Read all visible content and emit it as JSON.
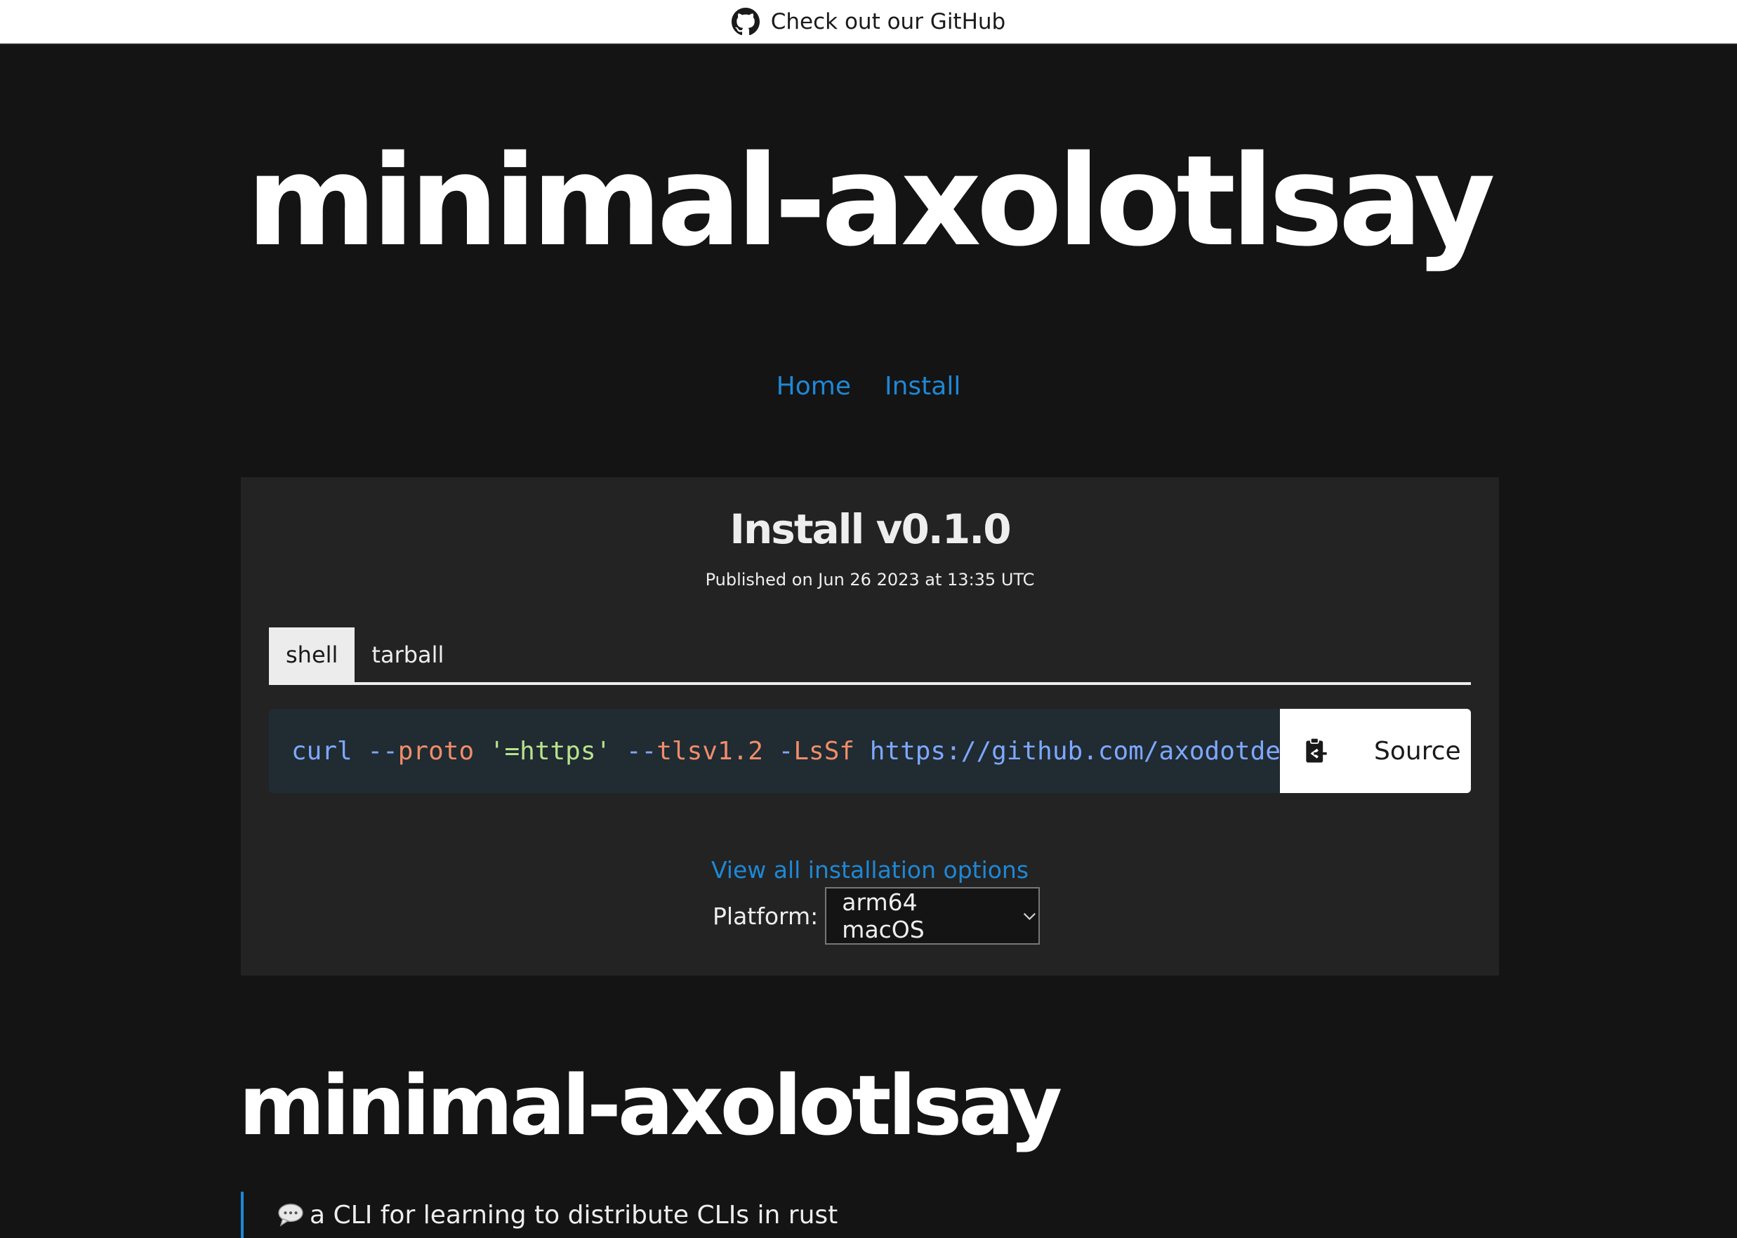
{
  "banner": {
    "icon": "github-icon",
    "text": "Check out our GitHub"
  },
  "hero": {
    "title": "minimal-axolotlsay"
  },
  "nav": {
    "items": [
      {
        "label": "Home"
      },
      {
        "label": "Install"
      }
    ]
  },
  "install": {
    "title": "Install v0.1.0",
    "published": "Published on Jun 26 2023 at 13:35 UTC",
    "tabs": [
      {
        "label": "shell",
        "active": true
      },
      {
        "label": "tarball",
        "active": false
      }
    ],
    "command": {
      "tokens": [
        {
          "text": "curl",
          "kind": "cmd"
        },
        {
          "text": "--",
          "kind": "dash"
        },
        {
          "text": "proto",
          "kind": "flag"
        },
        {
          "text": "'=https'",
          "kind": "str"
        },
        {
          "text": "--",
          "kind": "dash"
        },
        {
          "text": "tlsv1.2",
          "kind": "flag"
        },
        {
          "text": "-",
          "kind": "dash"
        },
        {
          "text": "LsSf",
          "kind": "flag"
        },
        {
          "text": "https://github.com/axodotde",
          "kind": "url"
        }
      ]
    },
    "copy_icon": "clipboard-icon",
    "source_label": "Source",
    "view_all_label": "View all installation options",
    "platform_label": "Platform:",
    "platform_selected": "arm64 macOS"
  },
  "readme": {
    "title": "minimal-axolotlsay",
    "quote_icon": "speech-bubble-icon",
    "quote_text": "a CLI for learning to distribute CLIs in rust"
  },
  "colors": {
    "background": "#141414",
    "panel": "#232323",
    "link": "#1e88d6",
    "code_bg": "#202b32"
  }
}
